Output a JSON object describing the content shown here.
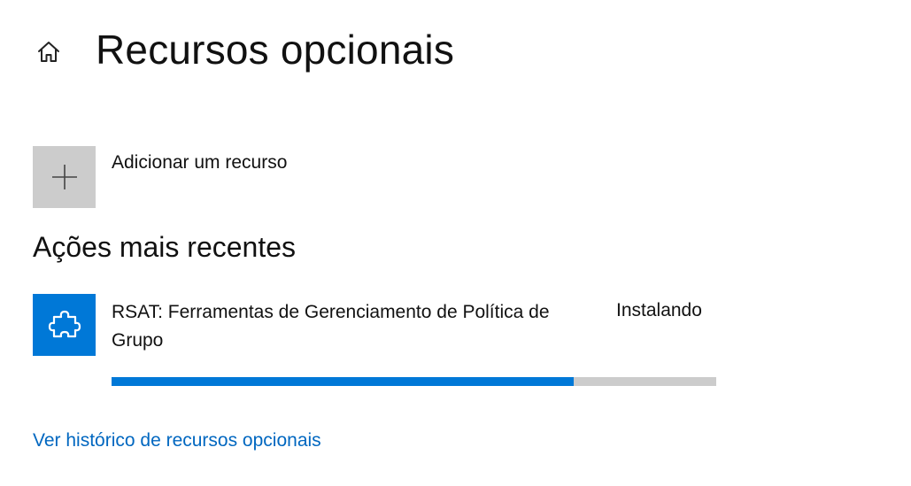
{
  "header": {
    "home_icon": "home-icon",
    "title": "Recursos opcionais"
  },
  "add_feature": {
    "icon": "plus-icon",
    "label": "Adicionar um recurso"
  },
  "recent_actions": {
    "heading": "Ações mais recentes",
    "items": [
      {
        "icon": "puzzle-piece-icon",
        "name": "RSAT: Ferramentas de Gerenciamento de Política de Grupo",
        "status": "Instalando",
        "progress_fraction": 0.765
      }
    ]
  },
  "history_link": {
    "label": "Ver histórico de recursos opcionais"
  },
  "colors": {
    "accent": "#0078d7",
    "tile_gray": "#cccccc",
    "link": "#0067c0",
    "progress_track": "#cccccc"
  }
}
